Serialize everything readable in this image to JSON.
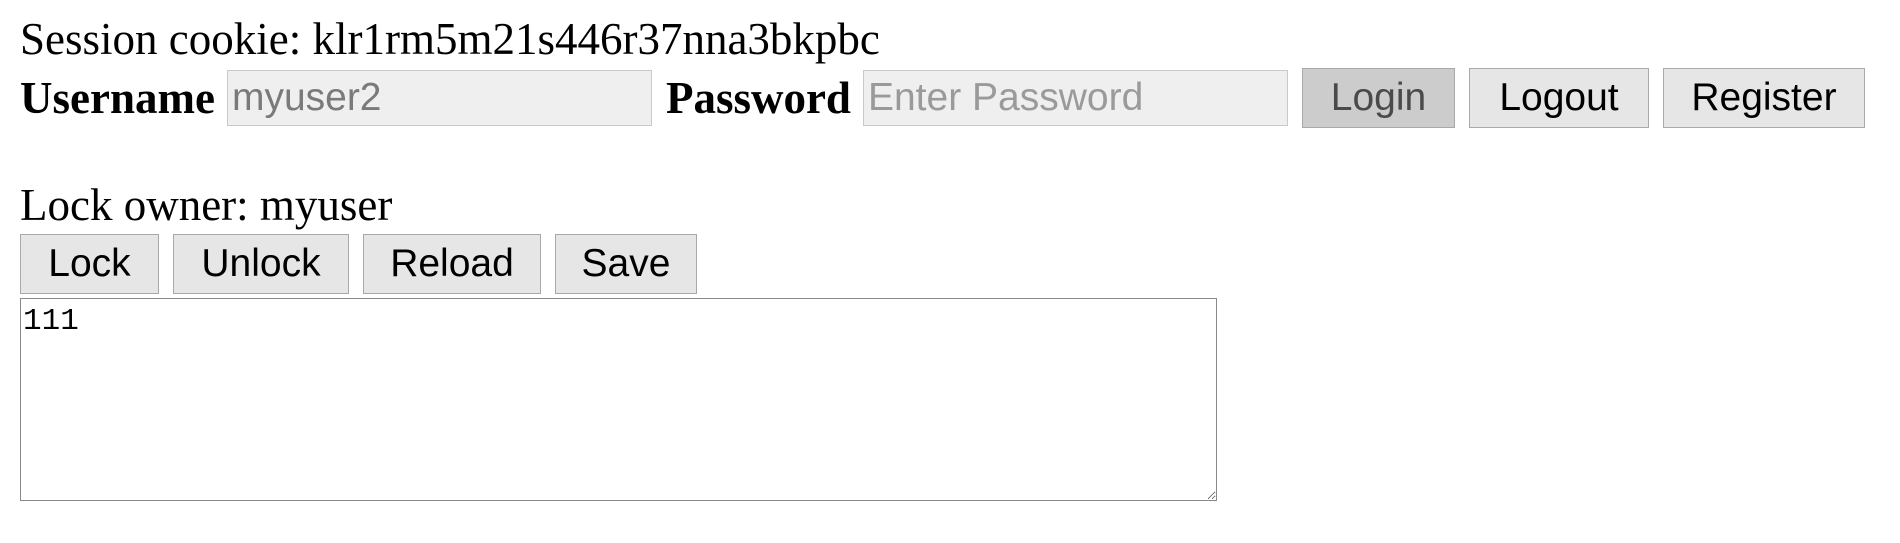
{
  "session": {
    "label": "Session cookie:",
    "value": "klr1rm5m21s446r37nna3bkpbc"
  },
  "auth": {
    "username_label": "Username",
    "username_value": "myuser2",
    "password_label": "Password",
    "password_value": "",
    "password_placeholder": "Enter Password",
    "login_label": "Login",
    "logout_label": "Logout",
    "register_label": "Register"
  },
  "lock": {
    "owner_label": "Lock owner:",
    "owner_value": "myuser"
  },
  "toolbar": {
    "lock_label": "Lock",
    "unlock_label": "Unlock",
    "reload_label": "Reload",
    "save_label": "Save"
  },
  "editor": {
    "content": "111"
  }
}
